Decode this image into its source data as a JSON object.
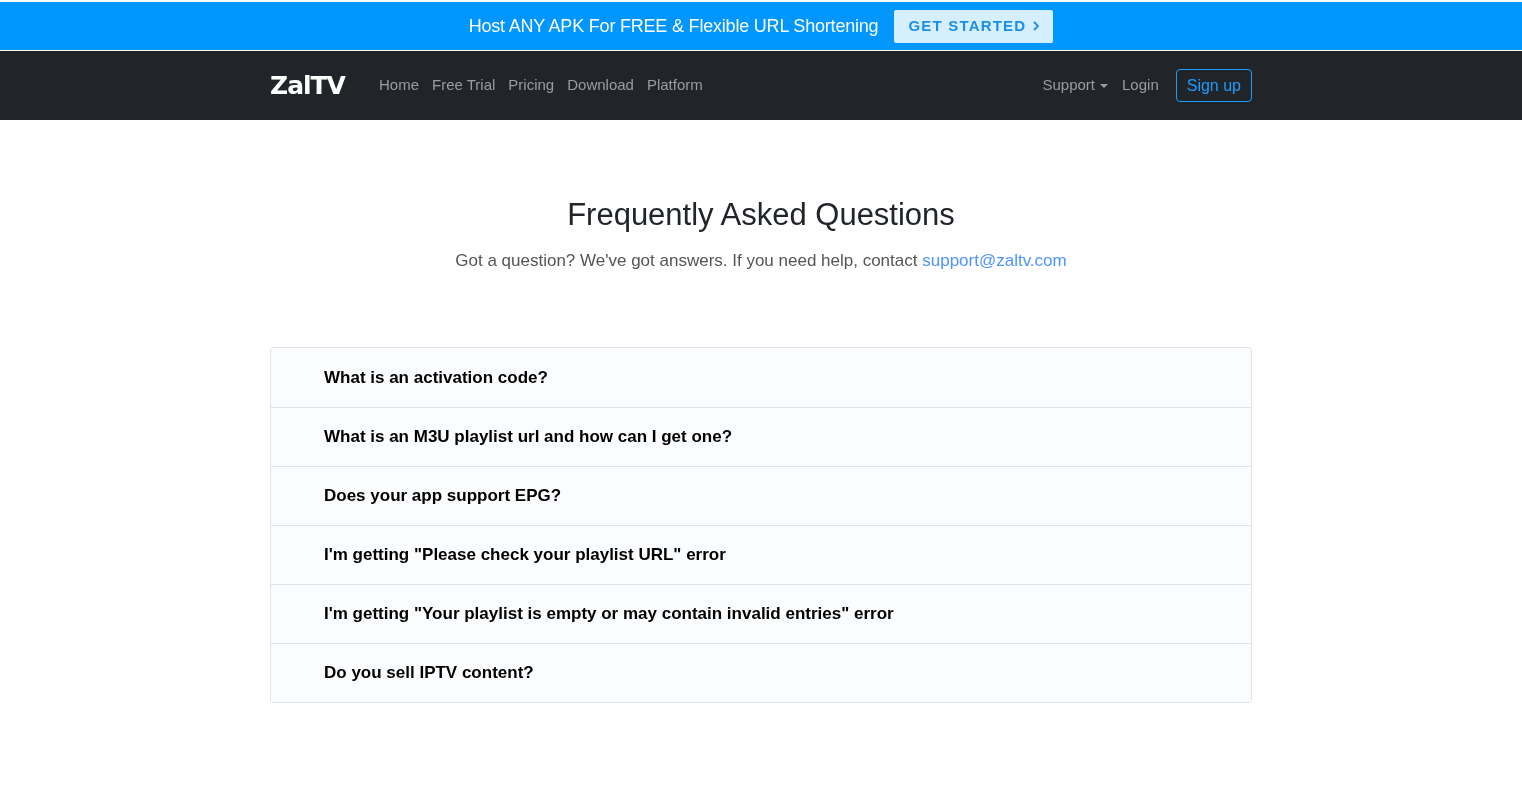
{
  "promo_banner": {
    "text": "Host ANY APK For FREE & Flexible URL Shortening",
    "button": "GET STARTED"
  },
  "navbar": {
    "logo": "ZalTV",
    "links": [
      "Home",
      "Free Trial",
      "Pricing",
      "Download",
      "Platform"
    ],
    "right_links": [
      {
        "label": "Support",
        "kind": "dropdown"
      },
      {
        "label": "Login",
        "kind": "link"
      }
    ],
    "signup_button": "Sign up"
  },
  "hero": {
    "title": "Frequently Asked Questions",
    "subtitle": "Got a question? We've got answers. If you need help, contact",
    "email": "support@zaltv.com"
  },
  "faq": [
    {
      "question": "What is an activation code?"
    },
    {
      "question": "What is an M3U playlist url and how can I get one?"
    },
    {
      "question": "Does your app support EPG?"
    },
    {
      "question": "I'm getting \"Please check your playlist URL\" error"
    },
    {
      "question": "I'm getting \"Your playlist is empty or may contain invalid entries\" error"
    },
    {
      "question": "Do you sell IPTV content?"
    }
  ]
}
